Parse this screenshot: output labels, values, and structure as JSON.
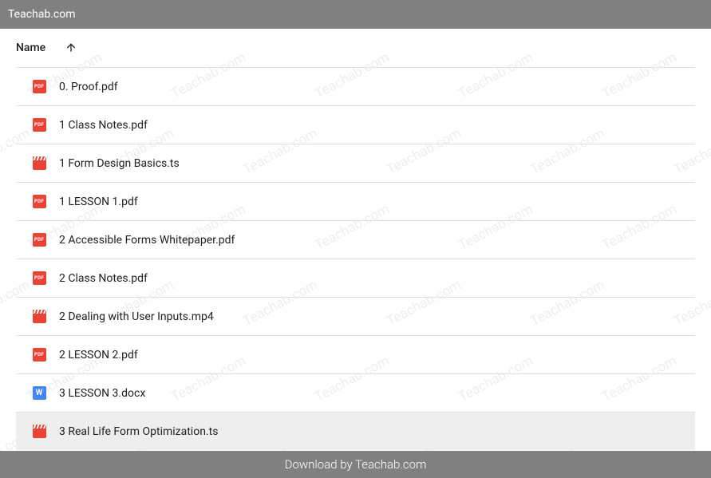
{
  "header": {
    "title": "Teachab.com"
  },
  "table": {
    "name_header": "Name",
    "sort_direction": "asc"
  },
  "files": [
    {
      "name": "0. Proof.pdf",
      "type": "pdf",
      "selected": false
    },
    {
      "name": "1 Class Notes.pdf",
      "type": "pdf",
      "selected": false
    },
    {
      "name": "1 Form Design Basics.ts",
      "type": "video",
      "selected": false
    },
    {
      "name": "1 LESSON 1.pdf",
      "type": "pdf",
      "selected": false
    },
    {
      "name": "2 Accessible Forms Whitepaper.pdf",
      "type": "pdf",
      "selected": false
    },
    {
      "name": "2 Class Notes.pdf",
      "type": "pdf",
      "selected": false
    },
    {
      "name": "2 Dealing with User Inputs.mp4",
      "type": "video",
      "selected": false
    },
    {
      "name": "2 LESSON 2.pdf",
      "type": "pdf",
      "selected": false
    },
    {
      "name": "3 LESSON 3.docx",
      "type": "docx",
      "selected": false
    },
    {
      "name": "3 Real Life Form Optimization.ts",
      "type": "video",
      "selected": true
    }
  ],
  "footer": {
    "text": "Download by Teachab.com"
  },
  "watermark": {
    "text": "Teachab.com"
  }
}
